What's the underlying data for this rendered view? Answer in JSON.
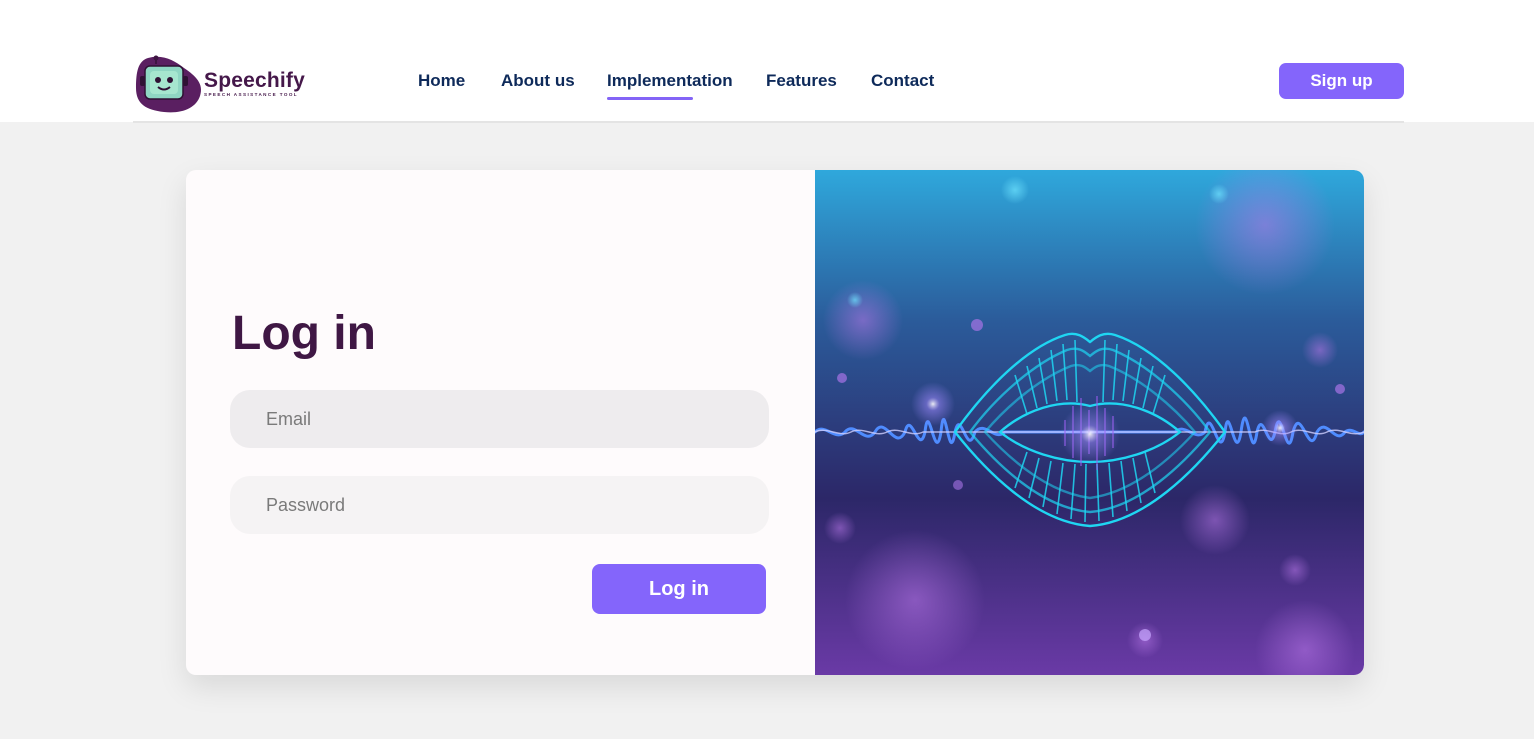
{
  "brand": {
    "name": "Speechify",
    "tagline": "SPEECH ASSISTANCE TOOL",
    "logo_icon": "robot-icon"
  },
  "nav": {
    "items": [
      {
        "label": "Home"
      },
      {
        "label": "About us"
      },
      {
        "label": "Implementation",
        "active": true
      },
      {
        "label": "Features"
      },
      {
        "label": "Contact"
      }
    ],
    "signup_label": "Sign up"
  },
  "login": {
    "title": "Log in",
    "email_placeholder": "Email",
    "password_placeholder": "Password",
    "submit_label": "Log in"
  },
  "hero": {
    "image": "glowing-lips-soundwave-illustration"
  },
  "colors": {
    "accent": "#8465fb",
    "nav_text": "#0e2a5a",
    "title": "#3f1744",
    "page_bg": "#f1f1f1"
  }
}
